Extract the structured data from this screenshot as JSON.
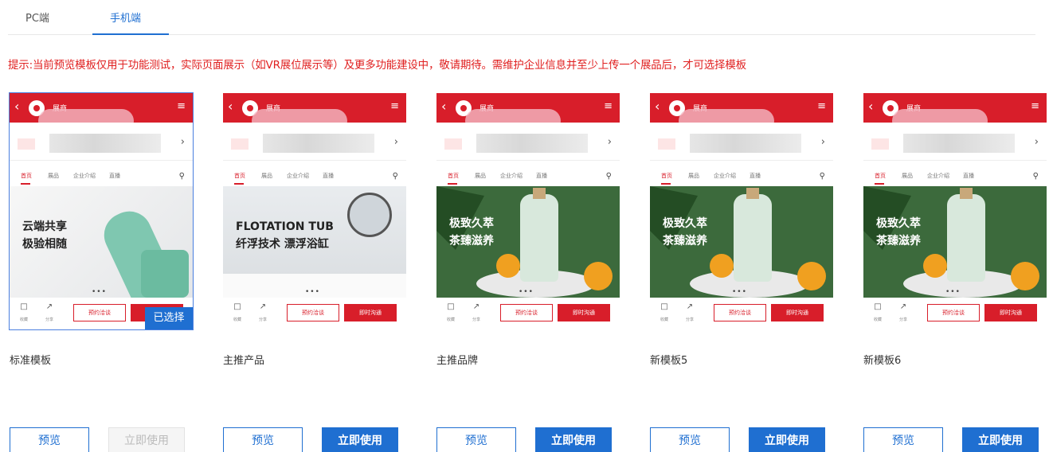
{
  "tabs": [
    {
      "label": "PC端",
      "active": false
    },
    {
      "label": "手机端",
      "active": true
    }
  ],
  "hint": "提示:当前预览模板仅用于功能测试，实际页面展示（如VR展位展示等）及更多功能建设中，敬请期待。需维护企业信息并至少上传一个展品后，才可选择模板",
  "colors": {
    "accent": "#1f6fd1",
    "phone_red": "#d81e2a",
    "hint_red": "#e02020"
  },
  "phone": {
    "header_title": "展商",
    "back_icon": "chevron-left-icon",
    "menu_icon": "menu-icon",
    "nav": [
      "首页",
      "展品",
      "企业介绍",
      "直播"
    ],
    "search_icon": "search-icon",
    "footer_icons": [
      "bookmark-icon",
      "share-icon"
    ],
    "footer_captions": [
      "收藏",
      "分享"
    ],
    "btn_appointment": "预约洽谈",
    "btn_chat": "即时沟通"
  },
  "templates": [
    {
      "name": "标准模板",
      "banner_lines": [
        "云端共享",
        "极验相随"
      ],
      "selected": true,
      "use_disabled": true
    },
    {
      "name": "主推产品",
      "banner_lines": [
        "FLOTATION TUB",
        "纤浮技术 漂浮浴缸"
      ],
      "selected": false,
      "use_disabled": false
    },
    {
      "name": "主推品牌",
      "banner_lines": [
        "极致久萃",
        "茶臻滋养"
      ],
      "selected": false,
      "use_disabled": false
    },
    {
      "name": "新模板5",
      "banner_lines": [
        "极致久萃",
        "茶臻滋养"
      ],
      "selected": false,
      "use_disabled": false
    },
    {
      "name": "新模板6",
      "banner_lines": [
        "极致久萃",
        "茶臻滋养"
      ],
      "selected": false,
      "use_disabled": false
    }
  ],
  "selected_badge": "已选择",
  "btn_preview": "预览",
  "btn_use": "立即使用"
}
